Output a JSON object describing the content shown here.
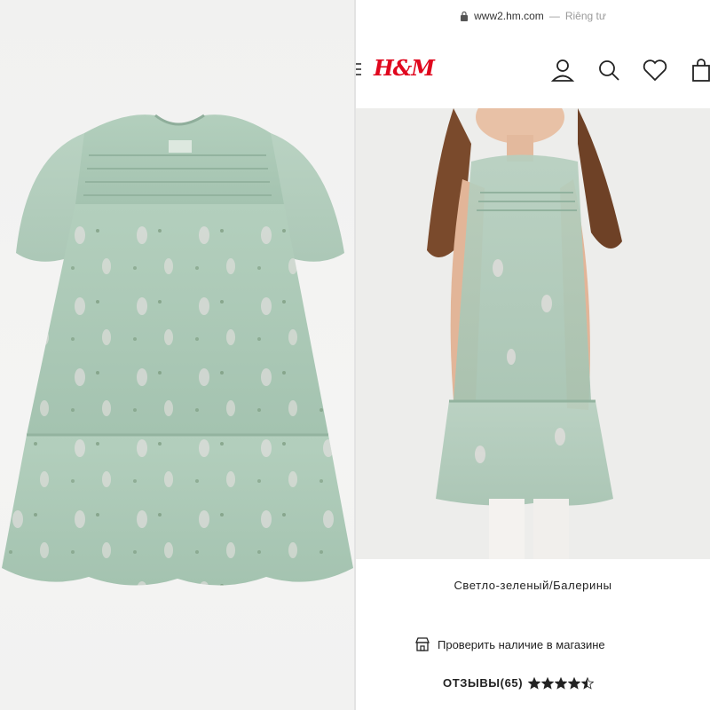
{
  "browser": {
    "url": "www2.hm.com",
    "separator": "—",
    "privacy_label": "Riêng tư"
  },
  "header": {
    "logo": "H&M",
    "icons": [
      "menu-icon",
      "account-icon",
      "search-icon",
      "favorites-icon",
      "shopping-bag-icon"
    ]
  },
  "product": {
    "color_name": "Светло-зеленый/Балерины",
    "store_check_label": "Проверить наличие в магазине",
    "reviews_label": "ОТЗЫВЫ(65)",
    "rating": 4.5,
    "rating_max": 5
  },
  "colors": {
    "brand_red": "#e0061d",
    "dress_mint": "#a9c7b4",
    "star": "#222222"
  }
}
